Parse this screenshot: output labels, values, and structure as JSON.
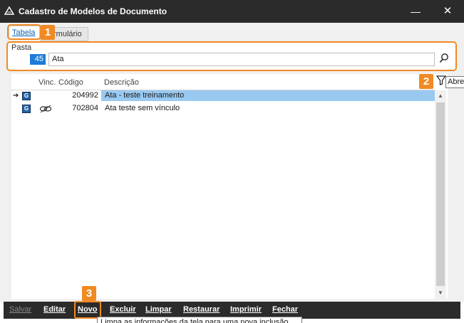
{
  "window": {
    "title": "Cadastro de Modelos de Documento",
    "minimize_label": "—",
    "close_label": "✕"
  },
  "tabs": [
    {
      "label": "Tabela"
    },
    {
      "label": "Formulário",
      "visible_text": "rmulário"
    }
  ],
  "callouts": [
    "1",
    "2",
    "3"
  ],
  "pasta": {
    "label": "Pasta",
    "code": "45",
    "name": "Ata"
  },
  "filter": {
    "tooltip": "Abre"
  },
  "grid": {
    "columns": [
      "Vinc.",
      "Código",
      "Descrição"
    ],
    "rows": [
      {
        "code": "204992",
        "description": "Ata - teste treinamento",
        "selected": true,
        "linked": false
      },
      {
        "code": "702804",
        "description": "Ata teste sem vínculo",
        "selected": false,
        "linked": true
      }
    ]
  },
  "toolbar": {
    "salvar": "Salvar",
    "editar": "Editar",
    "novo": "Novo",
    "excluir": "Excluir",
    "limpar": "Limpar",
    "restaurar": "Restaurar",
    "imprimir": "Imprimir",
    "fechar": "Fechar"
  },
  "novo_tooltip": "Limpa as informações da tela para uma nova inclusão",
  "colors": {
    "accent": "#f08a24",
    "selection": "#99c9f1",
    "titlebar": "#2b2b2b",
    "code_highlight": "#1e7bd6"
  },
  "icons": {
    "app": "document-icon",
    "search": "search-icon",
    "filter": "filter-icon",
    "type": "g-icon",
    "link": "link-icon",
    "current_row": "arrow-right-icon"
  }
}
